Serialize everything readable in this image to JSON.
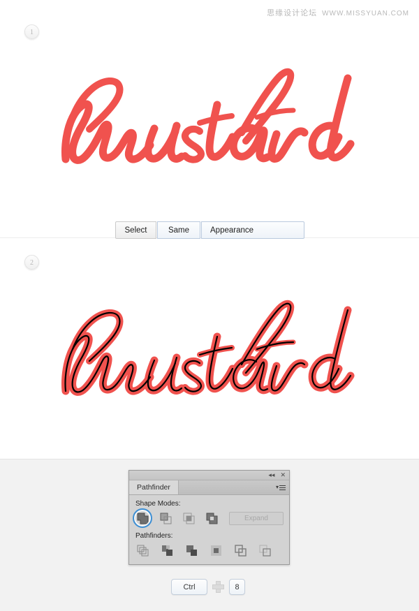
{
  "watermark": {
    "cn": "思缘设计论坛",
    "url": "WWW.MISSYUAN.COM"
  },
  "steps": [
    {
      "number": "1"
    },
    {
      "number": "2"
    }
  ],
  "artwork": {
    "word": "mustard",
    "fill_color": "#f0524e",
    "stroke_color": "#000000",
    "step1_caption": "mustard script lettering, solid red, no paths visible",
    "step2_caption": "mustard script lettering, red with black outlined paths"
  },
  "menu_row": {
    "select_label": "Select",
    "same_label": "Same",
    "appearance_label": "Appearance"
  },
  "pathfinder_panel": {
    "titlebar": {
      "collapse_icon": "◂◂",
      "close_icon": "✕"
    },
    "tab_label": "Pathfinder",
    "menu_icon": "panel-menu-icon",
    "shape_modes_label": "Shape Modes:",
    "shape_modes": [
      {
        "name": "unite",
        "selected": true
      },
      {
        "name": "minus-front",
        "selected": false
      },
      {
        "name": "intersect",
        "selected": false
      },
      {
        "name": "exclude",
        "selected": false
      }
    ],
    "expand_label": "Expand",
    "expand_enabled": false,
    "pathfinders_label": "Pathfinders:",
    "pathfinders": [
      {
        "name": "divide"
      },
      {
        "name": "trim"
      },
      {
        "name": "merge"
      },
      {
        "name": "crop"
      },
      {
        "name": "outline"
      },
      {
        "name": "minus-back"
      }
    ]
  },
  "shortcut": {
    "key1": "Ctrl",
    "plus": "plus-icon",
    "key2": "8"
  },
  "colors": {
    "accent_blue": "#3d8fd4",
    "art_red": "#f0524e",
    "page_bg": "#f2f2f2",
    "canvas_bg": "#ffffff",
    "panel_bg": "#d3d3d3"
  }
}
